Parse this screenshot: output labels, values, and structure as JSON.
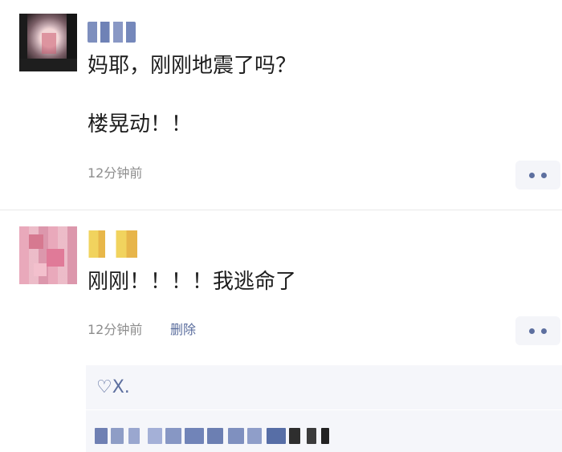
{
  "comments": [
    {
      "username": "趴趴",
      "line1": "妈耶，刚刚地震了吗？",
      "line2": "楼晃动！！",
      "time": "12分钟前"
    },
    {
      "username": "咩咩",
      "line1": "刚刚！！！！我逃命了",
      "time": "12分钟前",
      "delete_label": "删除",
      "reply_preview": "♡X.",
      "reply_obscured": "......"
    }
  ],
  "colors": {
    "link": "#5d6f9f",
    "meta": "#8d8d8d",
    "more_bg": "#f4f5f9"
  },
  "icons": {
    "more": "more-icon",
    "heart": "heart-icon"
  }
}
